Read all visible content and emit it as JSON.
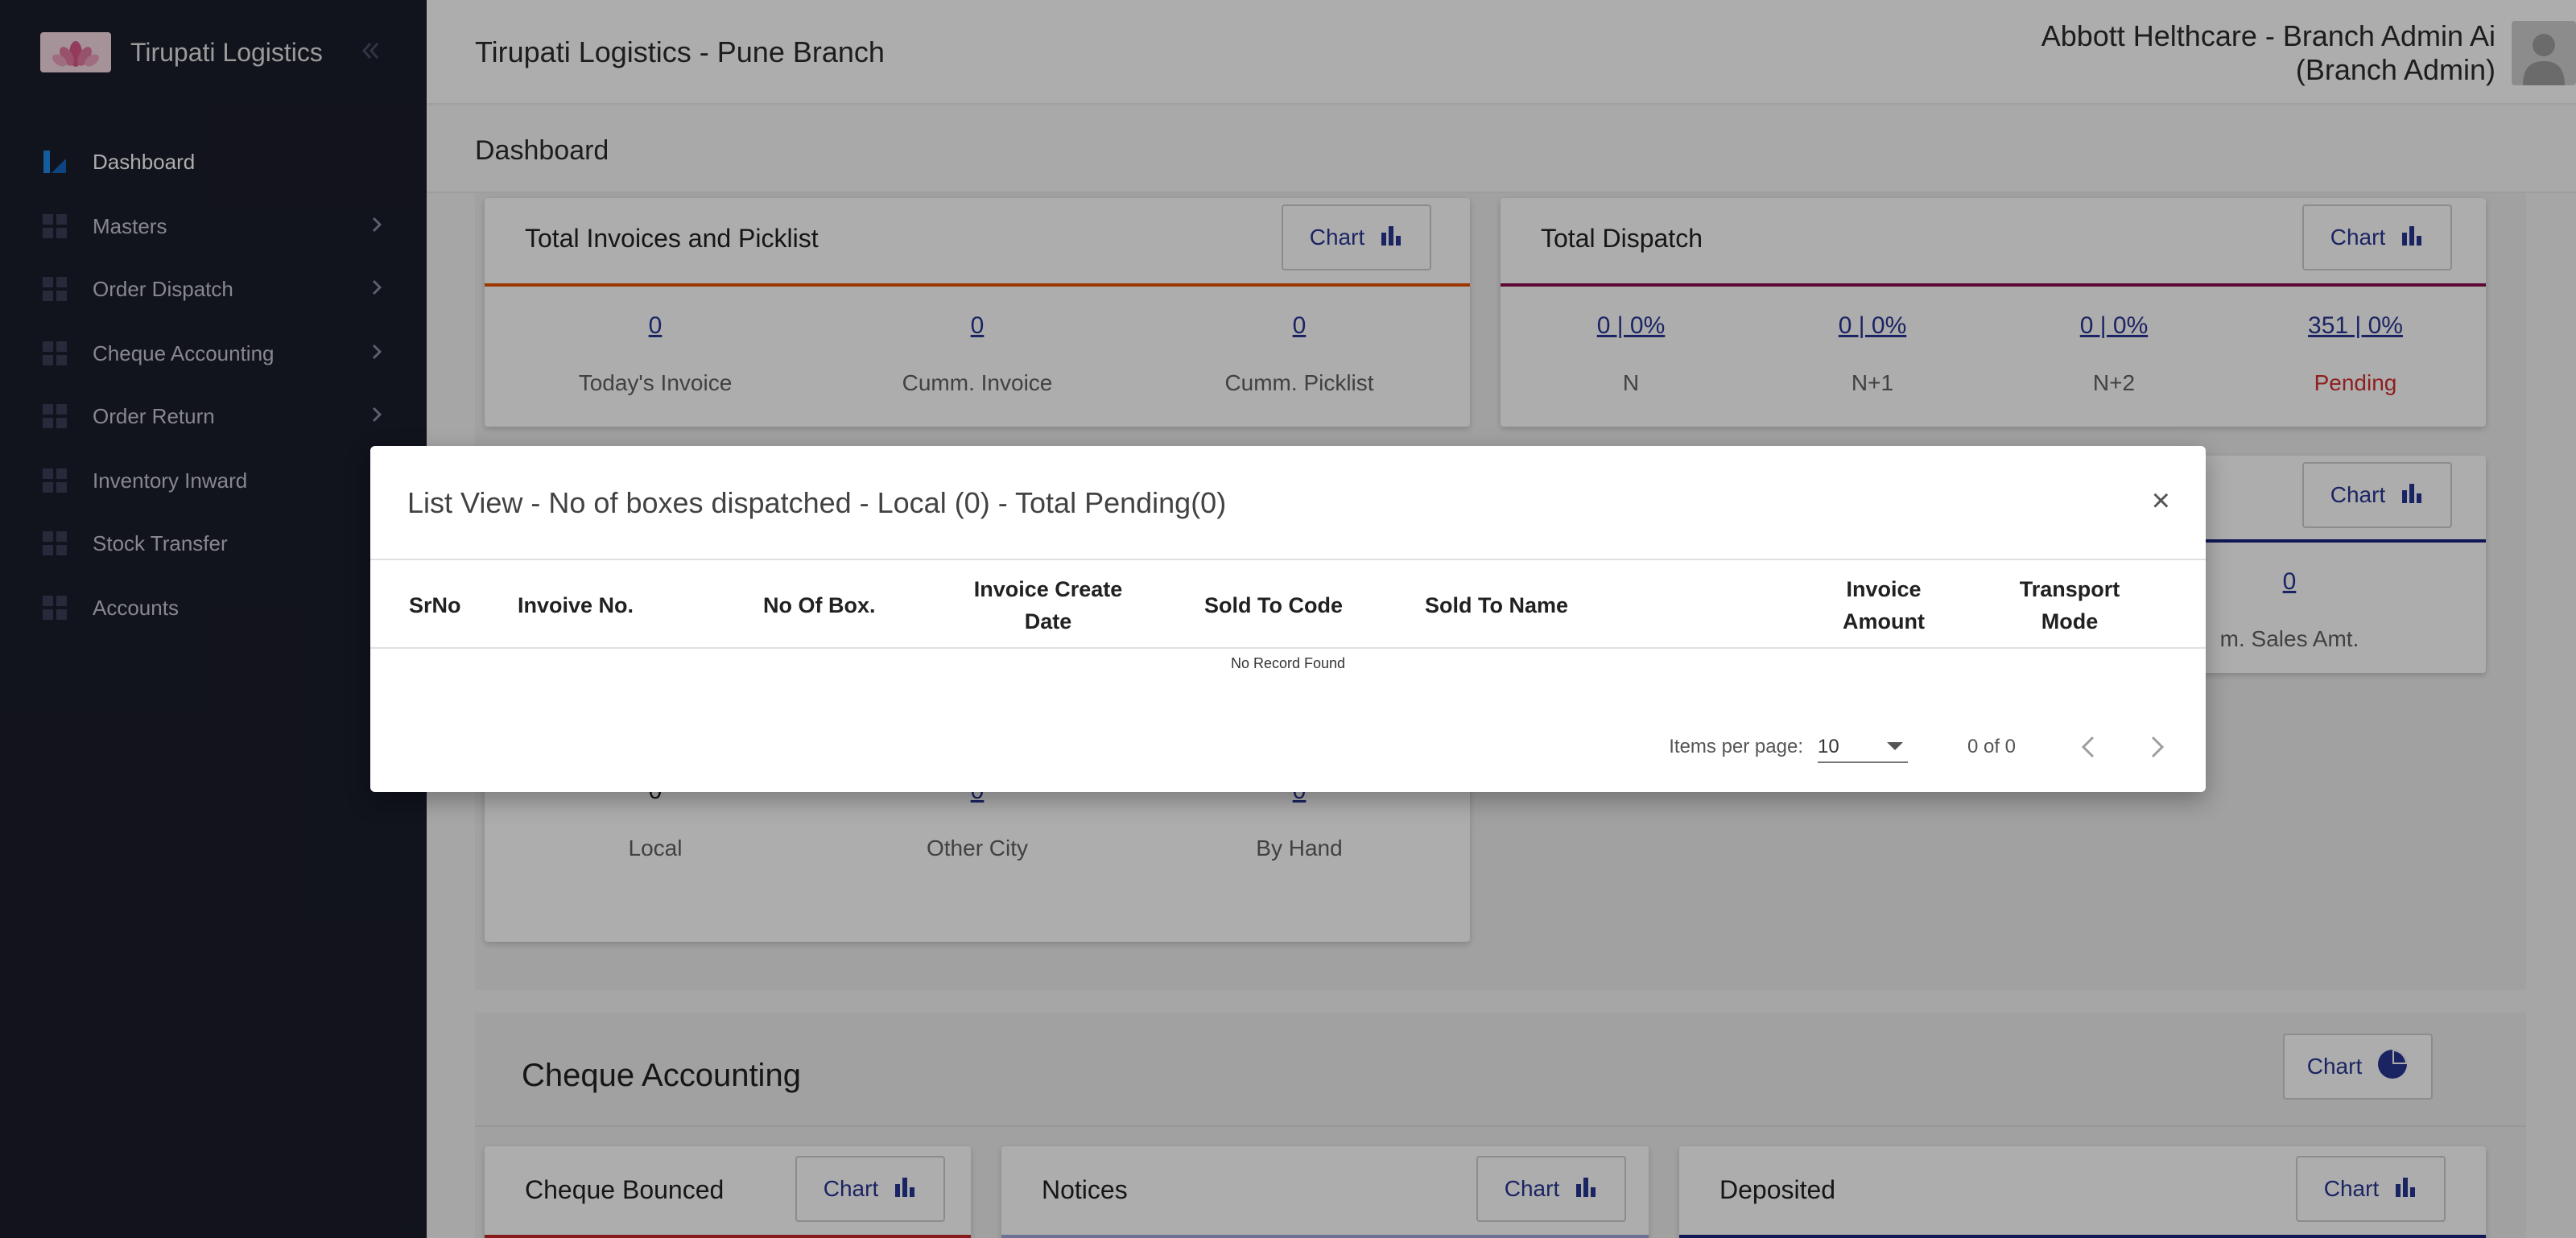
{
  "brand": {
    "name": "Tirupati Logistics"
  },
  "sidebar": {
    "items": [
      {
        "label": "Dashboard",
        "active": true
      },
      {
        "label": "Masters",
        "has_children": true
      },
      {
        "label": "Order Dispatch",
        "has_children": true
      },
      {
        "label": "Cheque Accounting",
        "has_children": true
      },
      {
        "label": "Order Return",
        "has_children": true
      },
      {
        "label": "Inventory Inward"
      },
      {
        "label": "Stock Transfer"
      },
      {
        "label": "Accounts"
      }
    ]
  },
  "header": {
    "branch_title": "Tirupati Logistics - Pune Branch",
    "user_name": "Abbott Helthcare - Branch Admin Ai",
    "user_role": "(Branch Admin)"
  },
  "page_title": "Dashboard",
  "chart_button_label": "Chart",
  "cards": {
    "invoices": {
      "title": "Total Invoices and Picklist",
      "stats": [
        {
          "value": "0",
          "label": "Today's Invoice"
        },
        {
          "value": "0",
          "label": "Cumm. Invoice"
        },
        {
          "value": "0",
          "label": "Cumm. Picklist"
        }
      ]
    },
    "dispatch": {
      "title": "Total Dispatch",
      "stats": [
        {
          "value": "0 | 0%",
          "label": "N"
        },
        {
          "value": "0 | 0%",
          "label": "N+1"
        },
        {
          "value": "0 | 0%",
          "label": "N+2"
        },
        {
          "value": "351 | 0%",
          "label": "Pending"
        }
      ]
    },
    "sales": {
      "partial_value": "0",
      "partial_label": "m. Sales Amt."
    },
    "boxes": {
      "stats": [
        {
          "value": "0",
          "label": "Local"
        },
        {
          "value": "0",
          "label": "Other City"
        },
        {
          "value": "0",
          "label": "By Hand"
        }
      ]
    }
  },
  "cheque_section": {
    "title": "Cheque Accounting",
    "cards": [
      {
        "title": "Cheque Bounced"
      },
      {
        "title": "Notices"
      },
      {
        "title": "Deposited"
      }
    ]
  },
  "modal": {
    "title": "List View - No of boxes dispatched - Local (0) - Total Pending(0)",
    "close": "×",
    "columns": [
      "SrNo",
      "Invoive No.",
      "No Of Box.",
      "Invoice Create Date",
      "Sold To Code",
      "Sold To Name",
      "Invoice Amount",
      "Transport Mode"
    ],
    "empty_text": "No Record Found",
    "paginator": {
      "items_per_page_label": "Items per page:",
      "items_per_page": "10",
      "range": "0 of 0"
    }
  },
  "colors": {
    "sidebar_bg": "#1a1c2b",
    "accent": "#283593",
    "pending_red": "#d32f2f",
    "invoices_line": "#e65100",
    "dispatch_line": "#880e4f",
    "sales_line": "#1a237e",
    "boxes_line": "#00897b",
    "cheque_bounced_line": "#c62828",
    "notices_line": "#9fa8da",
    "deposited_line": "#1a237e"
  }
}
